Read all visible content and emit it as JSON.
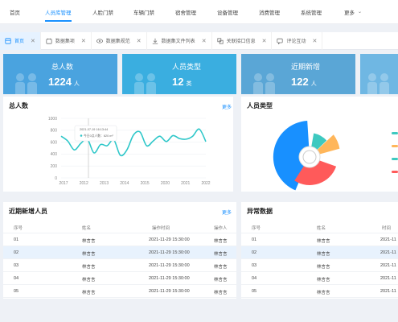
{
  "nav": {
    "items": [
      "首页",
      "人员库管理",
      "人脸门禁",
      "车辆门禁",
      "宿舍管理",
      "设备管理",
      "消费管理",
      "系统管理",
      "更多"
    ]
  },
  "tabs": [
    {
      "label": "首页",
      "icon": "home-icon"
    },
    {
      "label": "数据集项",
      "icon": "folder-icon"
    },
    {
      "label": "数据集规范",
      "icon": "eye-icon"
    },
    {
      "label": "数据集文件列表",
      "icon": "download-icon"
    },
    {
      "label": "关联接口信息",
      "icon": "link-icon"
    },
    {
      "label": "评论互动",
      "icon": "comment-icon"
    }
  ],
  "stats": [
    {
      "title": "总人数",
      "value": "1224",
      "unit": "人",
      "color": "#4aa3df"
    },
    {
      "title": "人员类型",
      "value": "12",
      "unit": "类",
      "color": "#3aaee0"
    },
    {
      "title": "近期新增",
      "value": "122",
      "unit": "人",
      "color": "#5aa6d6"
    }
  ],
  "total_panel": {
    "title": "总人数",
    "more": "更多"
  },
  "type_panel": {
    "title": "人员类型"
  },
  "recent_panel": {
    "title": "近期新增人员",
    "more": "更多"
  },
  "abnormal_panel": {
    "title": "异常数据"
  },
  "tooltip": {
    "date": "2021-07-19 16:13:44",
    "text": "今日0点人数：620 m²"
  },
  "chart_data": {
    "type": "line",
    "x": [
      "2017",
      "2012",
      "2013",
      "2014",
      "2015",
      "2020",
      "2021",
      "2022"
    ],
    "ylim": [
      0,
      1000
    ],
    "yticks": [
      0,
      200,
      400,
      600,
      800,
      1000
    ],
    "values": [
      700,
      620,
      470,
      580,
      650,
      420,
      560,
      540,
      640,
      380,
      470,
      720,
      770,
      540,
      620,
      700,
      610,
      710,
      660,
      650,
      700,
      820,
      610
    ],
    "color": "#2ec7c9",
    "grid": true
  },
  "rose_colors": [
    "#1890ff",
    "#ff5a5a",
    "#ffb65a",
    "#3ec9c0"
  ],
  "legend_colors": [
    "#3ec9c0",
    "#ffb65a",
    "#3ec9c0",
    "#ff5a5a"
  ],
  "recent_table": {
    "headers": [
      "序号",
      "姓名",
      "操作时间",
      "操作人"
    ],
    "rows": [
      [
        "01",
        "林言言",
        "2021-11-29 15:30:00",
        "林言言"
      ],
      [
        "02",
        "林言言",
        "2021-11-29 15:30:00",
        "林言言"
      ],
      [
        "03",
        "林言言",
        "2021-11-29 15:30:00",
        "林言言"
      ],
      [
        "04",
        "林言言",
        "2021-11-29 15:30:00",
        "林言言"
      ],
      [
        "05",
        "林言言",
        "2021-11-29 15:30:00",
        "林言言"
      ]
    ]
  },
  "abnormal_table": {
    "headers": [
      "序号",
      "姓名",
      "时间"
    ],
    "rows": [
      [
        "01",
        "林言言",
        "2021-11"
      ],
      [
        "02",
        "林言言",
        "2021-11"
      ],
      [
        "03",
        "林言言",
        "2021-11"
      ],
      [
        "04",
        "林言言",
        "2021-11"
      ],
      [
        "05",
        "林言言",
        "2021-11"
      ]
    ]
  }
}
